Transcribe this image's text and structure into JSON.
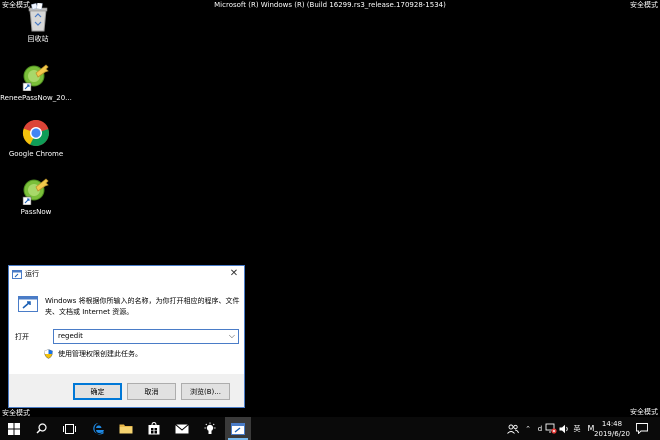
{
  "watermark": {
    "safe_mode": "安全模式",
    "build": "Microsoft (R) Windows (R) (Build 16299.rs3_release.170928-1534)"
  },
  "desktop": {
    "icons": [
      {
        "label": "回收站",
        "icon": "recycle-bin-icon"
      },
      {
        "label": "ReneePassNow_20...",
        "icon": "passnow-key-icon"
      },
      {
        "label": "Google Chrome",
        "icon": "chrome-icon"
      },
      {
        "label": "PassNow",
        "icon": "passnow-key-icon"
      }
    ]
  },
  "run_dialog": {
    "title": "运行",
    "description": "Windows 将根据你所输入的名称，为你打开相应的程序、文件夹、文档或 Internet 资源。",
    "open_label": "打开",
    "input_value": "regedit",
    "admin_note": "使用管理权限创建此任务。",
    "buttons": {
      "ok": "确定",
      "cancel": "取消",
      "browse": "浏览(B)..."
    }
  },
  "taskbar": {
    "ime": "英",
    "clock_time": "14:48",
    "clock_date": "2019/6/20",
    "tray_letter": "M",
    "tray_d": "d"
  },
  "colors": {
    "accent": "#0078d7",
    "taskbar_bg": "#0a0a0a",
    "desktop_bg": "#000000"
  }
}
